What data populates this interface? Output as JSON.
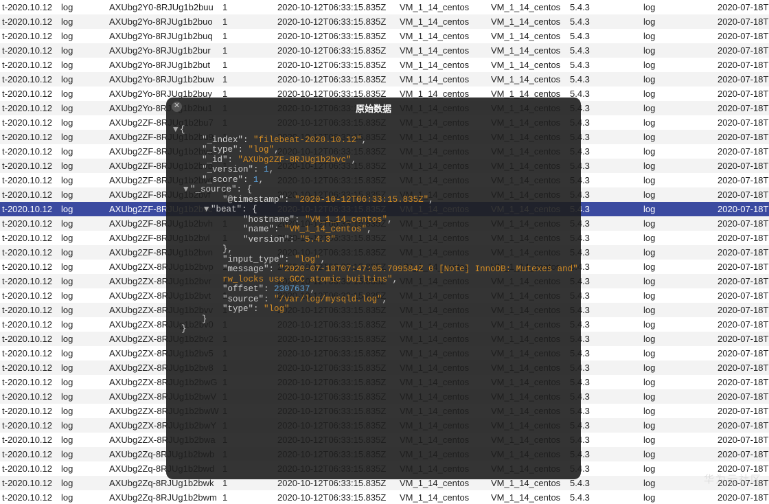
{
  "watermark": "华为云社区",
  "overlay": {
    "title": "原始数据",
    "json": {
      "_index": "filebeat-2020.10.12",
      "_type": "log",
      "_id": "AXUbg2ZF-8RJUg1b2bvc",
      "_version": 1,
      "_score": 1,
      "_source": {
        "@timestamp": "2020-10-12T06:33:15.835Z",
        "beat": {
          "hostname": "VM_1_14_centos",
          "name": "VM_1_14_centos",
          "version": "5.4.3"
        },
        "input_type": "log",
        "message": "2020-07-18T07:47:05.709584Z 0 [Note] InnoDB: Mutexes and rw_locks use GCC atomic builtins",
        "offset": 2307637,
        "source": "/var/log/mysqld.log",
        "type": "log"
      }
    }
  },
  "rows": [
    {
      "idx": "t-2020.10.12",
      "type": "log",
      "id": "AXUbg2Y0-8RJUg1b2buu",
      "ver": "1",
      "ts": "2020-10-12T06:33:15.835Z",
      "h": "VM_1_14_centos",
      "n": "VM_1_14_centos",
      "v": "5.4.3",
      "it": "log",
      "d": "2020-07-18T"
    },
    {
      "idx": "t-2020.10.12",
      "type": "log",
      "id": "AXUbg2Yo-8RJUg1b2buo",
      "ver": "1",
      "ts": "2020-10-12T06:33:15.835Z",
      "h": "VM_1_14_centos",
      "n": "VM_1_14_centos",
      "v": "5.4.3",
      "it": "log",
      "d": "2020-07-18T"
    },
    {
      "idx": "t-2020.10.12",
      "type": "log",
      "id": "AXUbg2Yo-8RJUg1b2buq",
      "ver": "1",
      "ts": "2020-10-12T06:33:15.835Z",
      "h": "VM_1_14_centos",
      "n": "VM_1_14_centos",
      "v": "5.4.3",
      "it": "log",
      "d": "2020-07-18T"
    },
    {
      "idx": "t-2020.10.12",
      "type": "log",
      "id": "AXUbg2Yo-8RJUg1b2bur",
      "ver": "1",
      "ts": "2020-10-12T06:33:15.835Z",
      "h": "VM_1_14_centos",
      "n": "VM_1_14_centos",
      "v": "5.4.3",
      "it": "log",
      "d": "2020-07-18T"
    },
    {
      "idx": "t-2020.10.12",
      "type": "log",
      "id": "AXUbg2Yo-8RJUg1b2but",
      "ver": "1",
      "ts": "2020-10-12T06:33:15.835Z",
      "h": "VM_1_14_centos",
      "n": "VM_1_14_centos",
      "v": "5.4.3",
      "it": "log",
      "d": "2020-07-18T"
    },
    {
      "idx": "t-2020.10.12",
      "type": "log",
      "id": "AXUbg2Yo-8RJUg1b2buw",
      "ver": "1",
      "ts": "2020-10-12T06:33:15.835Z",
      "h": "VM_1_14_centos",
      "n": "VM_1_14_centos",
      "v": "5.4.3",
      "it": "log",
      "d": "2020-07-18T"
    },
    {
      "idx": "t-2020.10.12",
      "type": "log",
      "id": "AXUbg2Yo-8RJUg1b2buy",
      "ver": "1",
      "ts": "2020-10-12T06:33:15.835Z",
      "h": "VM_1_14_centos",
      "n": "VM_1_14_centos",
      "v": "5.4.3",
      "it": "log",
      "d": "2020-07-18T"
    },
    {
      "idx": "t-2020.10.12",
      "type": "log",
      "id": "AXUbg2Yo-8RJUg1b2bu1",
      "ver": "1",
      "ts": "2020-10-12T06:33:15.835Z",
      "h": "VM_1_14_centos",
      "n": "VM_1_14_centos",
      "v": "5.4.3",
      "it": "log",
      "d": "2020-07-18T"
    },
    {
      "idx": "t-2020.10.12",
      "type": "log",
      "id": "AXUbg2ZF-8RJUg1b2bu7",
      "ver": "1",
      "ts": "2020-10-12T06:33:15.835Z",
      "h": "VM_1_14_centos",
      "n": "VM_1_14_centos",
      "v": "5.4.3",
      "it": "log",
      "d": "2020-07-18T"
    },
    {
      "idx": "t-2020.10.12",
      "type": "log",
      "id": "AXUbg2ZF-8RJUg1b2bu9",
      "ver": "1",
      "ts": "2020-10-12T06:33:15.835Z",
      "h": "VM_1_14_centos",
      "n": "VM_1_14_centos",
      "v": "5.4.3",
      "it": "log",
      "d": "2020-07-18T"
    },
    {
      "idx": "t-2020.10.12",
      "type": "log",
      "id": "AXUbg2ZF-8RJUg1b2bva",
      "ver": "1",
      "ts": "2020-10-12T06:33:15.835Z",
      "h": "VM_1_14_centos",
      "n": "VM_1_14_centos",
      "v": "5.4.3",
      "it": "log",
      "d": "2020-07-18T"
    },
    {
      "idx": "t-2020.10.12",
      "type": "log",
      "id": "AXUbg2ZF-8RJUg1b2bvb",
      "ver": "1",
      "ts": "2020-10-12T06:33:15.835Z",
      "h": "VM_1_14_centos",
      "n": "VM_1_14_centos",
      "v": "5.4.3",
      "it": "log",
      "d": "2020-07-18T"
    },
    {
      "idx": "t-2020.10.12",
      "type": "log",
      "id": "AXUbg2ZF-8RJUg1b2bvd",
      "ver": "1",
      "ts": "2020-10-12T06:33:15.835Z",
      "h": "VM_1_14_centos",
      "n": "VM_1_14_centos",
      "v": "5.4.3",
      "it": "log",
      "d": "2020-07-18T"
    },
    {
      "idx": "t-2020.10.12",
      "type": "log",
      "id": "AXUbg2ZF-8RJUg1b2bvf",
      "ver": "1",
      "ts": "2020-10-12T06:33:15.835Z",
      "h": "VM_1_14_centos",
      "n": "VM_1_14_centos",
      "v": "5.4.3",
      "it": "log",
      "d": "2020-07-18T"
    },
    {
      "idx": "t-2020.10.12",
      "type": "log",
      "id": "AXUbg2ZF-8RJUg1b2bvc",
      "ver": "1",
      "ts": "2020-10-12T06:33:15.835Z",
      "h": "VM_1_14_centos",
      "n": "VM_1_14_centos",
      "v": "5.4.3",
      "it": "log",
      "d": "2020-07-18T",
      "sel": true
    },
    {
      "idx": "t-2020.10.12",
      "type": "log",
      "id": "AXUbg2ZF-8RJUg1b2bvh",
      "ver": "1",
      "ts": "2020-10-12T06:33:15.835Z",
      "h": "VM_1_14_centos",
      "n": "VM_1_14_centos",
      "v": "5.4.3",
      "it": "log",
      "d": "2020-07-18T"
    },
    {
      "idx": "t-2020.10.12",
      "type": "log",
      "id": "AXUbg2ZF-8RJUg1b2bvl",
      "ver": "1",
      "ts": "2020-10-12T06:33:15.835Z",
      "h": "VM_1_14_centos",
      "n": "VM_1_14_centos",
      "v": "5.4.3",
      "it": "log",
      "d": "2020-07-18T"
    },
    {
      "idx": "t-2020.10.12",
      "type": "log",
      "id": "AXUbg2ZF-8RJUg1b2bvn",
      "ver": "1",
      "ts": "2020-10-12T06:33:15.835Z",
      "h": "VM_1_14_centos",
      "n": "VM_1_14_centos",
      "v": "5.4.3",
      "it": "log",
      "d": "2020-07-18T"
    },
    {
      "idx": "t-2020.10.12",
      "type": "log",
      "id": "AXUbg2ZX-8RJUg1b2bvp",
      "ver": "1",
      "ts": "2020-10-12T06:33:15.835Z",
      "h": "VM_1_14_centos",
      "n": "VM_1_14_centos",
      "v": "5.4.3",
      "it": "log",
      "d": "2020-07-18T"
    },
    {
      "idx": "t-2020.10.12",
      "type": "log",
      "id": "AXUbg2ZX-8RJUg1b2bvr",
      "ver": "1",
      "ts": "2020-10-12T06:33:15.835Z",
      "h": "VM_1_14_centos",
      "n": "VM_1_14_centos",
      "v": "5.4.3",
      "it": "log",
      "d": "2020-07-18T"
    },
    {
      "idx": "t-2020.10.12",
      "type": "log",
      "id": "AXUbg2ZX-8RJUg1b2bvt",
      "ver": "1",
      "ts": "2020-10-12T06:33:15.835Z",
      "h": "VM_1_14_centos",
      "n": "VM_1_14_centos",
      "v": "5.4.3",
      "it": "log",
      "d": "2020-07-18T"
    },
    {
      "idx": "t-2020.10.12",
      "type": "log",
      "id": "AXUbg2ZX-8RJUg1b2bvv",
      "ver": "1",
      "ts": "2020-10-12T06:33:15.835Z",
      "h": "VM_1_14_centos",
      "n": "VM_1_14_centos",
      "v": "5.4.3",
      "it": "log",
      "d": "2020-07-18T"
    },
    {
      "idx": "t-2020.10.12",
      "type": "log",
      "id": "AXUbg2ZX-8RJUg1b2bv0",
      "ver": "1",
      "ts": "2020-10-12T06:33:15.835Z",
      "h": "VM_1_14_centos",
      "n": "VM_1_14_centos",
      "v": "5.4.3",
      "it": "log",
      "d": "2020-07-18T"
    },
    {
      "idx": "t-2020.10.12",
      "type": "log",
      "id": "AXUbg2ZX-8RJUg1b2bv2",
      "ver": "1",
      "ts": "2020-10-12T06:33:15.835Z",
      "h": "VM_1_14_centos",
      "n": "VM_1_14_centos",
      "v": "5.4.3",
      "it": "log",
      "d": "2020-07-18T"
    },
    {
      "idx": "t-2020.10.12",
      "type": "log",
      "id": "AXUbg2ZX-8RJUg1b2bv5",
      "ver": "1",
      "ts": "2020-10-12T06:33:15.835Z",
      "h": "VM_1_14_centos",
      "n": "VM_1_14_centos",
      "v": "5.4.3",
      "it": "log",
      "d": "2020-07-18T"
    },
    {
      "idx": "t-2020.10.12",
      "type": "log",
      "id": "AXUbg2ZX-8RJUg1b2bv8",
      "ver": "1",
      "ts": "2020-10-12T06:33:15.835Z",
      "h": "VM_1_14_centos",
      "n": "VM_1_14_centos",
      "v": "5.4.3",
      "it": "log",
      "d": "2020-07-18T"
    },
    {
      "idx": "t-2020.10.12",
      "type": "log",
      "id": "AXUbg2ZX-8RJUg1b2bwG",
      "ver": "1",
      "ts": "2020-10-12T06:33:15.835Z",
      "h": "VM_1_14_centos",
      "n": "VM_1_14_centos",
      "v": "5.4.3",
      "it": "log",
      "d": "2020-07-18T"
    },
    {
      "idx": "t-2020.10.12",
      "type": "log",
      "id": "AXUbg2ZX-8RJUg1b2bwV",
      "ver": "1",
      "ts": "2020-10-12T06:33:15.835Z",
      "h": "VM_1_14_centos",
      "n": "VM_1_14_centos",
      "v": "5.4.3",
      "it": "log",
      "d": "2020-07-18T"
    },
    {
      "idx": "t-2020.10.12",
      "type": "log",
      "id": "AXUbg2ZX-8RJUg1b2bwW",
      "ver": "1",
      "ts": "2020-10-12T06:33:15.835Z",
      "h": "VM_1_14_centos",
      "n": "VM_1_14_centos",
      "v": "5.4.3",
      "it": "log",
      "d": "2020-07-18T"
    },
    {
      "idx": "t-2020.10.12",
      "type": "log",
      "id": "AXUbg2ZX-8RJUg1b2bwY",
      "ver": "1",
      "ts": "2020-10-12T06:33:15.835Z",
      "h": "VM_1_14_centos",
      "n": "VM_1_14_centos",
      "v": "5.4.3",
      "it": "log",
      "d": "2020-07-18T"
    },
    {
      "idx": "t-2020.10.12",
      "type": "log",
      "id": "AXUbg2ZX-8RJUg1b2bwa",
      "ver": "1",
      "ts": "2020-10-12T06:33:15.835Z",
      "h": "VM_1_14_centos",
      "n": "VM_1_14_centos",
      "v": "5.4.3",
      "it": "log",
      "d": "2020-07-18T"
    },
    {
      "idx": "t-2020.10.12",
      "type": "log",
      "id": "AXUbg2Zq-8RJUg1b2bwb",
      "ver": "1",
      "ts": "2020-10-12T06:33:15.835Z",
      "h": "VM_1_14_centos",
      "n": "VM_1_14_centos",
      "v": "5.4.3",
      "it": "log",
      "d": "2020-07-18T"
    },
    {
      "idx": "t-2020.10.12",
      "type": "log",
      "id": "AXUbg2Zq-8RJUg1b2bwd",
      "ver": "1",
      "ts": "2020-10-12T06:33:15.835Z",
      "h": "VM_1_14_centos",
      "n": "VM_1_14_centos",
      "v": "5.4.3",
      "it": "log",
      "d": "2020-07-18T"
    },
    {
      "idx": "t-2020.10.12",
      "type": "log",
      "id": "AXUbg2Zq-8RJUg1b2bwk",
      "ver": "1",
      "ts": "2020-10-12T06:33:15.835Z",
      "h": "VM_1_14_centos",
      "n": "VM_1_14_centos",
      "v": "5.4.3",
      "it": "log",
      "d": "2020-07-18T"
    },
    {
      "idx": "t-2020.10.12",
      "type": "log",
      "id": "AXUbg2Zq-8RJUg1b2bwm",
      "ver": "1",
      "ts": "2020-10-12T06:33:15.835Z",
      "h": "VM_1_14_centos",
      "n": "VM_1_14_centos",
      "v": "5.4.3",
      "it": "log",
      "d": "2020-07-18T"
    }
  ]
}
